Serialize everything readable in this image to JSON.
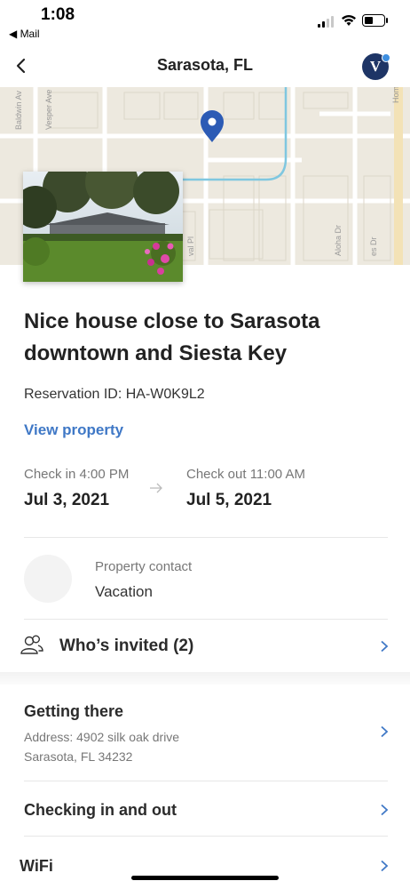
{
  "status_bar": {
    "time": "1:08",
    "back_app": "◀ Mail"
  },
  "nav": {
    "title": "Sarasota, FL",
    "avatar_letter": "V"
  },
  "map": {
    "street_labels": [
      "Baldwin Av",
      "Vesper Ave",
      "Hom",
      "Aloha Dr",
      "es Dr",
      "val Pl"
    ],
    "pin_color": "#2c5bb5"
  },
  "listing": {
    "title": "Nice house close to Sarasota downtown and Siesta Key",
    "reservation_id": "Reservation ID: HA-W0K9L2",
    "view_property": "View property"
  },
  "stay": {
    "check_in_label": "Check in 4:00 PM",
    "check_in_date": "Jul 3, 2021",
    "check_out_label": "Check out 11:00 AM",
    "check_out_date": "Jul 5, 2021"
  },
  "contact": {
    "label": "Property contact",
    "name": "Vacation"
  },
  "invited": {
    "label": "Who’s invited (2)"
  },
  "sections": {
    "getting_there": {
      "title": "Getting there",
      "address_line1": "Address: 4902 silk oak drive",
      "address_line2": "Sarasota, FL 34232"
    },
    "checking": {
      "title": "Checking in and out"
    },
    "wifi": {
      "title": "WiFi"
    }
  },
  "colors": {
    "accent": "#3f78c6",
    "brand_navy": "#1e3566",
    "map_bg": "#ede9df"
  }
}
